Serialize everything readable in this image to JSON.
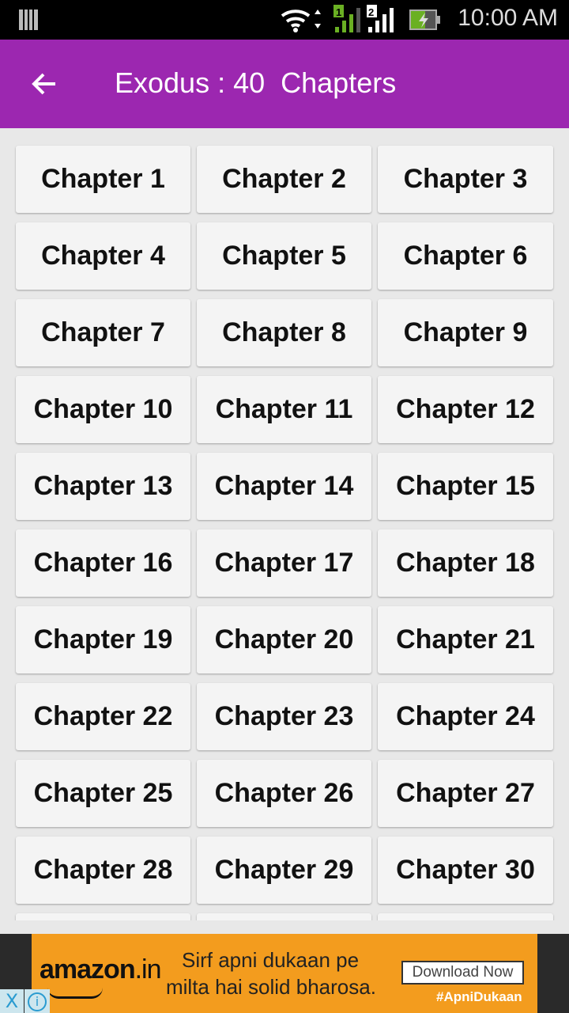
{
  "status_bar": {
    "time": "10:00 AM",
    "icons": [
      "notification-icon",
      "wifi-icon",
      "sim1-signal-icon",
      "sim2-signal-icon",
      "battery-charging-icon"
    ]
  },
  "app_bar": {
    "title": "Exodus : 40  Chapters",
    "back_icon": "arrow-left-icon",
    "color": "#9c27b0"
  },
  "chapters": [
    "Chapter 1",
    "Chapter 2",
    "Chapter 3",
    "Chapter 4",
    "Chapter 5",
    "Chapter 6",
    "Chapter 7",
    "Chapter 8",
    "Chapter 9",
    "Chapter 10",
    "Chapter 11",
    "Chapter 12",
    "Chapter 13",
    "Chapter 14",
    "Chapter 15",
    "Chapter 16",
    "Chapter 17",
    "Chapter 18",
    "Chapter 19",
    "Chapter 20",
    "Chapter 21",
    "Chapter 22",
    "Chapter 23",
    "Chapter 24",
    "Chapter 25",
    "Chapter 26",
    "Chapter 27",
    "Chapter 28",
    "Chapter 29",
    "Chapter 30"
  ],
  "ad": {
    "brand": "amazon",
    "brand_suffix": ".in",
    "line1": "Sirf apni dukaan pe",
    "line2": "milta hai solid bharosa.",
    "cta": "Download Now",
    "hashtag": "#ApniDukaan",
    "close": "X",
    "info": "i"
  }
}
